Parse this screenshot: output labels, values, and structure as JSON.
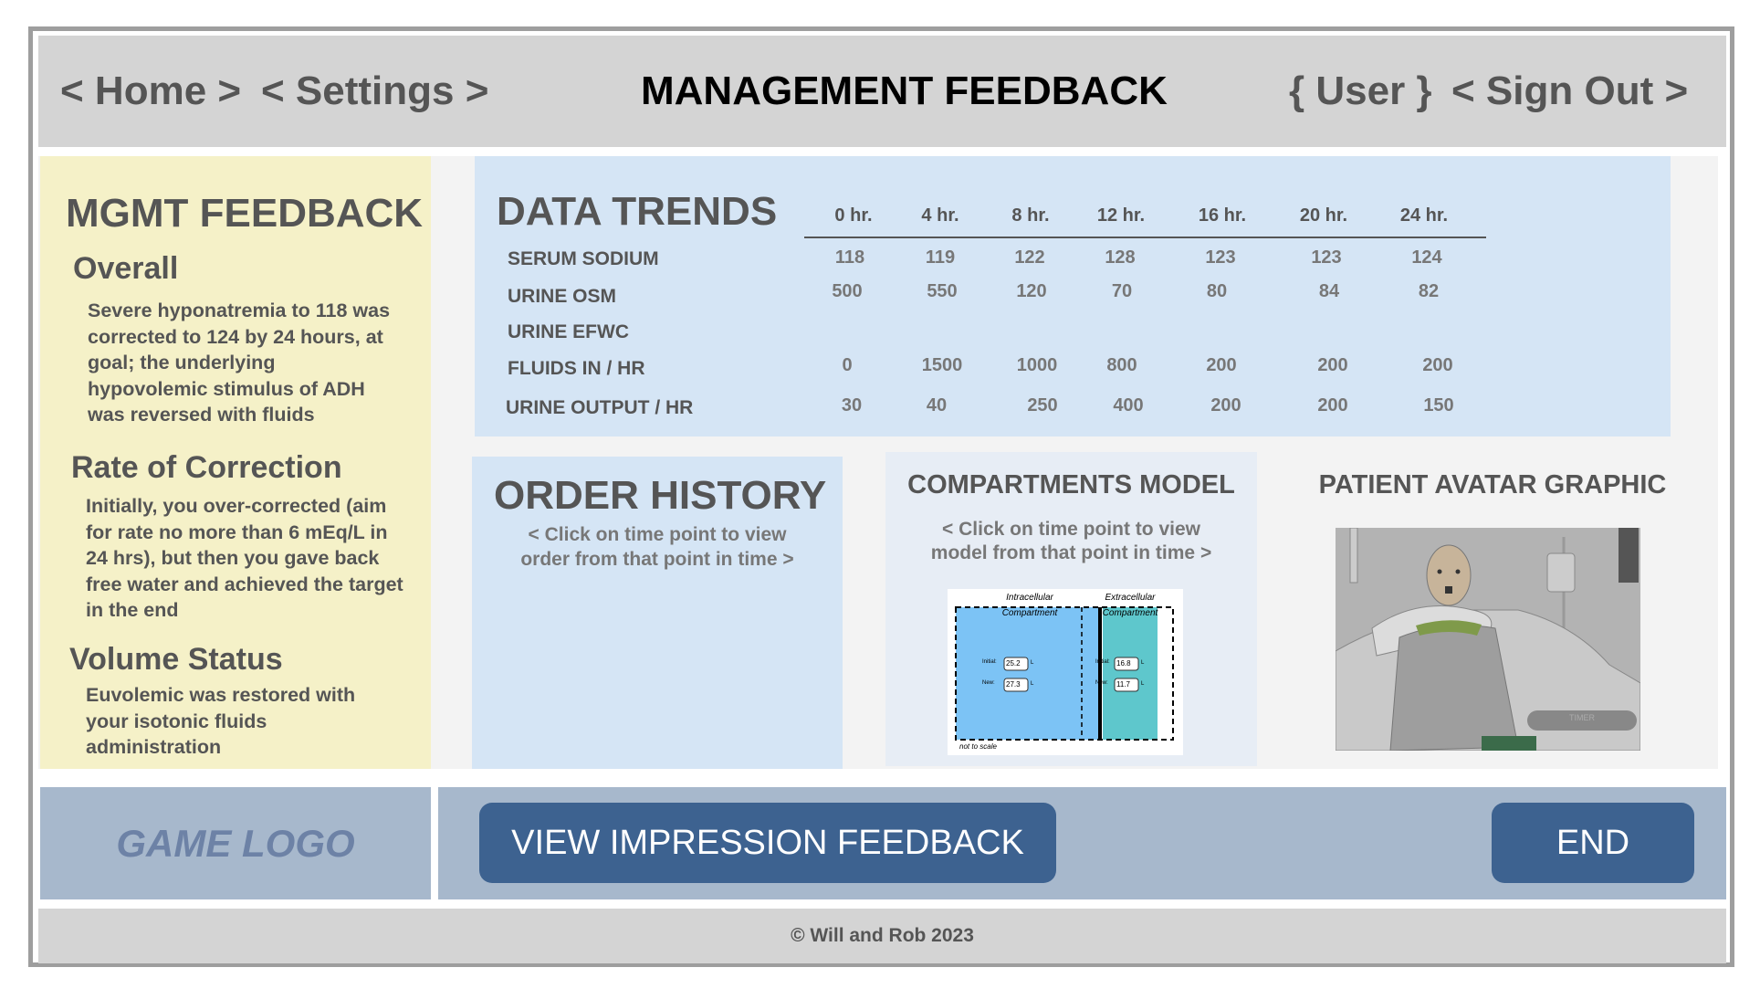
{
  "header": {
    "home": "< Home >",
    "settings": "< Settings >",
    "title": "MANAGEMENT FEEDBACK",
    "user": "{ User }",
    "sign_out": "< Sign Out >"
  },
  "feedback": {
    "title": "MGMT FEEDBACK",
    "sections": [
      {
        "heading": "Overall",
        "text": "Severe hyponatremia to 118 was corrected to 124 by 24 hours, at goal; the underlying hypovolemic stimulus of ADH was reversed with fluids"
      },
      {
        "heading": "Rate of Correction",
        "text": "Initially, you over-corrected (aim for rate no more than 6 mEq/L in 24 hrs), but then you gave back free water and achieved the target in the end"
      },
      {
        "heading": "Volume Status",
        "text": "Euvolemic was restored with your isotonic fluids administration"
      }
    ]
  },
  "data_trends": {
    "title": "DATA TRENDS",
    "columns": [
      "0 hr.",
      "4 hr.",
      "8 hr.",
      "12 hr.",
      "16 hr.",
      "20 hr.",
      "24 hr."
    ],
    "rows": [
      {
        "label": "SERUM SODIUM",
        "values": [
          "118",
          "119",
          "122",
          "128",
          "123",
          "123",
          "124"
        ]
      },
      {
        "label": "URINE OSM",
        "values": [
          "500",
          "550",
          "120",
          "70",
          "80",
          "84",
          "82"
        ]
      },
      {
        "label": "URINE EFWC",
        "values": [
          "",
          "",
          "",
          "",
          "",
          "",
          ""
        ]
      },
      {
        "label": "FLUIDS IN / HR",
        "values": [
          "0",
          "1500",
          "1000",
          "800",
          "200",
          "200",
          "200"
        ]
      },
      {
        "label": "URINE OUTPUT / HR",
        "values": [
          "30",
          "40",
          "250",
          "400",
          "200",
          "200",
          "150"
        ]
      }
    ]
  },
  "order_history": {
    "title": "ORDER HISTORY",
    "hint_line1": "< Click on time point to view",
    "hint_line2": "order from that point in time >"
  },
  "compartments": {
    "title": "COMPARTMENTS MODEL",
    "hint_line1": "< Click on time point to view",
    "hint_line2": "model from that point in time >",
    "intracellular_label": "Intracellular",
    "extracellular_label": "Extracellular",
    "compartment_word": "Compartment",
    "initial_label": "Initial:",
    "new_label": "New:",
    "intra_initial": "25.2",
    "intra_new": "27.3",
    "extra_initial": "16.8",
    "extra_new": "11.7",
    "unit": "L",
    "scale_note": "not to scale",
    "colors": {
      "intracellular": "#7cc3f5",
      "extracellular": "#5ec7cc"
    }
  },
  "avatar": {
    "title": "PATIENT AVATAR GRAPHIC",
    "timer_label": "TIMER"
  },
  "logo": {
    "text": "GAME LOGO"
  },
  "buttons": {
    "impression": "VIEW IMPRESSION FEEDBACK",
    "end": "END"
  },
  "footer": {
    "text": "© Will and Rob 2023"
  }
}
